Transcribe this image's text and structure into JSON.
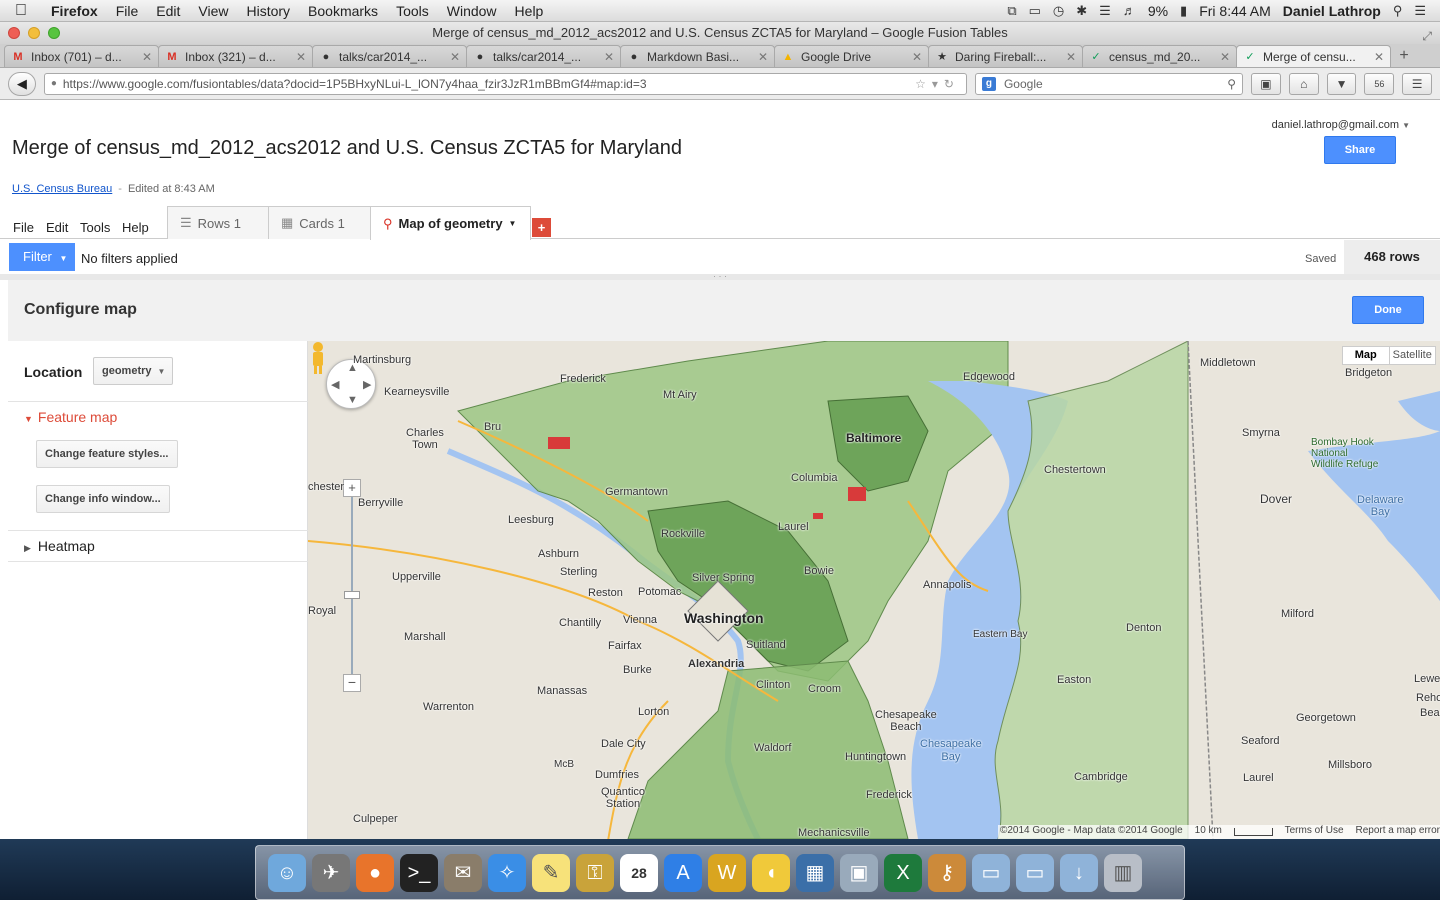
{
  "menubar": {
    "apple": "",
    "items": [
      "Firefox",
      "File",
      "Edit",
      "View",
      "History",
      "Bookmarks",
      "Tools",
      "Window",
      "Help"
    ],
    "battery": "9%",
    "clock": "Fri 8:44 AM",
    "user": "Daniel Lathrop"
  },
  "window": {
    "title": "Merge of census_md_2012_acs2012 and U.S. Census ZCTA5 for Maryland – Google Fusion Tables"
  },
  "tabs": [
    {
      "label": "Inbox (701) – d...",
      "icon": "gmail-icon"
    },
    {
      "label": "Inbox (321) – d...",
      "icon": "gmail-icon"
    },
    {
      "label": "talks/car2014_...",
      "icon": "github-icon"
    },
    {
      "label": "talks/car2014_...",
      "icon": "github-icon"
    },
    {
      "label": "Markdown Basi...",
      "icon": "github-icon"
    },
    {
      "label": "Google Drive",
      "icon": "drive-icon"
    },
    {
      "label": "Daring Fireball:...",
      "icon": "star-icon"
    },
    {
      "label": "census_md_20...",
      "icon": "fusion-icon"
    },
    {
      "label": "Merge of censu...",
      "icon": "fusion-icon",
      "active": true
    }
  ],
  "nav": {
    "url": "https://www.google.com/fusiontables/data?docid=1P5BHxyNLui-L_lON7y4haa_fzir3JzR1mBBmGf4#map:id=3",
    "search_placeholder": "Google"
  },
  "doc": {
    "title": "Merge of census_md_2012_acs2012 and U.S. Census ZCTA5 for Maryland",
    "account": "daniel.lathrop@gmail.com",
    "share_label": "Share",
    "source_link": "U.S. Census Bureau",
    "edited": "Edited at 8:43 AM"
  },
  "ft_menu": [
    "File",
    "Edit",
    "Tools",
    "Help"
  ],
  "view_tabs": [
    {
      "label": "Rows 1",
      "icon": "rows-icon"
    },
    {
      "label": "Cards 1",
      "icon": "cards-icon"
    },
    {
      "label": "Map of geometry",
      "icon": "map-pin-icon",
      "active": true
    }
  ],
  "add_tab": "+",
  "filter": {
    "button_label": "Filter",
    "status": "No filters applied",
    "saved": "Saved",
    "rows": "468 rows"
  },
  "config": {
    "title": "Configure map",
    "done_label": "Done",
    "location_label": "Location",
    "location_value": "geometry",
    "feature_map_label": "Feature map",
    "change_styles_label": "Change feature styles...",
    "change_info_label": "Change info window...",
    "heatmap_label": "Heatmap"
  },
  "map": {
    "map_type_options": [
      "Map",
      "Satellite"
    ],
    "selected_map_type": "Map",
    "attribution": "©2014 Google - Map data ©2014 Google",
    "scale": "10 km",
    "terms": "Terms of Use",
    "report": "Report a map error",
    "colors": {
      "land": "#e9e5dc",
      "water": "#a3c4f1",
      "polygon_fill": "#9cc784",
      "polygon_dark": "#5f9a4c",
      "highlight": "#d83a3a"
    },
    "labels": {
      "washington": "Washington",
      "baltimore": "Baltimore",
      "alexandria": "Alexandria",
      "martinsburg": "Martinsburg",
      "kearneysville": "Kearneysville",
      "charles_town": "Charles\nTown",
      "berryville": "Berryville",
      "leesburg": "Leesburg",
      "ashburn": "Ashburn",
      "sterling": "Sterling",
      "reston": "Reston",
      "chantilly": "Chantilly",
      "vienna": "Vienna",
      "fairfax": "Fairfax",
      "burke": "Burke",
      "manassas": "Manassas",
      "lorton": "Lorton",
      "dale_city": "Dale City",
      "dumfries": "Dumfries",
      "quantico": "Quantico\nStation",
      "warrenton": "Warrenton",
      "marshall": "Marshall",
      "upperville": "Upperville",
      "culpeper": "Culpeper",
      "rockville": "Rockville",
      "germantown": "Germantown",
      "columbia": "Columbia",
      "laurel": "Laurel",
      "bowie": "Bowie",
      "annapolis": "Annapolis",
      "waldorf": "Waldorf",
      "clinton": "Clinton",
      "croom": "Croom",
      "chestertown": "Chestertown",
      "denton": "Denton",
      "easton": "Easton",
      "cambridge": "Cambridge",
      "dover": "Dover",
      "smyrna": "Smyrna",
      "milford": "Milford",
      "georgetown": "Georgetown",
      "seaford": "Seaford",
      "laurel_de": "Laurel",
      "millsboro": "Millsboro",
      "lewes": "Lewes",
      "middletown": "Middletown",
      "bridgeton": "Bridgeton",
      "chesapeake_bay": "Chesapeake\nBay",
      "delaware_bay": "Delaware\nBay",
      "bombay_hook": "Bombay Hook\nNational\nWildlife Refuge",
      "mt_airy": "Mt Airy",
      "frederick": "Frederick",
      "edgewood": "Edgewood",
      "potomac": "Potomac",
      "silver_spring": "Silver Spring",
      "suitland": "Suitland",
      "huntingtown": "Huntingtown",
      "chesapeake_beach": "Chesapeake\nBeach",
      "eastern_bay": "Eastern Bay",
      "mechanicsville": "Mechanicsville",
      "frederick_md": "Frederick",
      "mcb": "McB",
      "beach_de": "Bea",
      "reho": "Reho",
      "royal": "Royal",
      "chester": "chester",
      "bru": "Bru"
    }
  },
  "dock": [
    "finder-icon",
    "launchpad-icon",
    "firefox-icon",
    "terminal-icon",
    "mail-icon",
    "safari-icon",
    "notes-icon",
    "keychain-icon",
    "calendar-icon",
    "appstore-icon",
    "wunderlist-icon",
    "cyberduck-icon",
    "dashboard-icon",
    "preview-icon",
    "excel-icon",
    "keys-icon",
    "folder-icon",
    "documents-icon",
    "downloads-icon",
    "trash-icon"
  ],
  "dock_calendar_day": "28"
}
